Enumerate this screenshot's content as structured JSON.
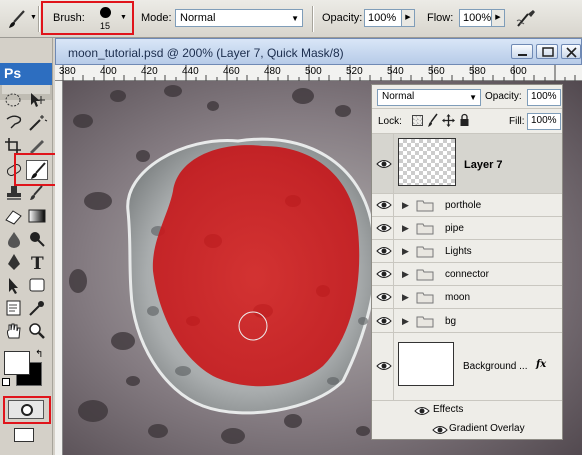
{
  "options_bar": {
    "tool_icon": "brush-tool-icon",
    "brush_label": "Brush:",
    "brush_size": "15",
    "mode_label": "Mode:",
    "mode_value": "Normal",
    "opacity_label": "Opacity:",
    "opacity_value": "100%",
    "flow_label": "Flow:",
    "flow_value": "100%",
    "airbrush_icon": "airbrush-icon"
  },
  "toolbox": {
    "logo": "Ps",
    "highlight_color": "#e0141b"
  },
  "document": {
    "title": "moon_tutorial.psd @ 200% (Layer 7, Quick Mask/8)",
    "ruler_ticks": [
      "380",
      "400",
      "420",
      "440",
      "460",
      "480",
      "500",
      "520",
      "540",
      "560",
      "580",
      "600"
    ],
    "quick_mask_color": "#d0171c"
  },
  "layers_panel": {
    "blend_mode": "Normal",
    "opacity_label": "Opacity:",
    "opacity_value": "100%",
    "lock_label": "Lock:",
    "fill_label": "Fill:",
    "fill_value": "100%",
    "active_layer": "Layer 7",
    "groups": [
      "porthole",
      "pipe",
      "Lights",
      "connector",
      "moon",
      "bg"
    ],
    "background_layer": "Background ...",
    "fx_label": "fx",
    "effects_label": "Effects",
    "effect_item": "Gradient Overlay"
  }
}
